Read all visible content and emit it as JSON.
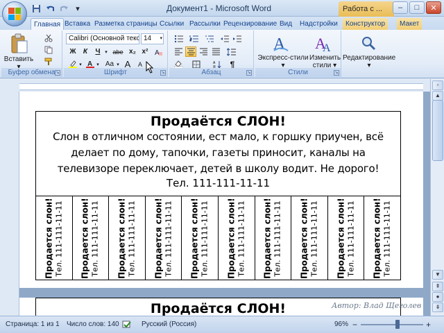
{
  "window": {
    "title": "Документ1 - Microsoft Word",
    "context_tab_title": "Работа с ...",
    "minimize": "–",
    "maximize": "□",
    "close": "✕"
  },
  "qat": {
    "save_icon": "save-icon",
    "undo_icon": "undo-icon",
    "redo_icon": "redo-icon",
    "customize_icon": "customize-qat-icon"
  },
  "tabs": [
    {
      "label": "Главная",
      "active": true
    },
    {
      "label": "Вставка"
    },
    {
      "label": "Разметка страницы"
    },
    {
      "label": "Ссылки"
    },
    {
      "label": "Рассылки"
    },
    {
      "label": "Рецензирование"
    },
    {
      "label": "Вид"
    },
    {
      "label": "Надстройки"
    },
    {
      "label": "Конструктор",
      "contextual": true
    },
    {
      "label": "Макет",
      "contextual": true
    }
  ],
  "ribbon": {
    "clipboard": {
      "label": "Буфер обмена",
      "paste_label": "Вставить"
    },
    "font": {
      "label": "Шрифт",
      "font_name": "Calibri (Основной текс",
      "font_size": "14",
      "bold": "Ж",
      "italic": "К",
      "underline": "Ч",
      "strike": "abe",
      "subscript": "x₂",
      "superscript": "x²",
      "change_case": "Aa",
      "grow": "A",
      "shrink": "A"
    },
    "paragraph": {
      "label": "Абзац"
    },
    "styles": {
      "label": "Стили",
      "express_label_1": "Экспресс-стили",
      "change_label_1": "Изменить",
      "change_label_2": "стили"
    },
    "editing": {
      "label": "Редактирование"
    }
  },
  "document": {
    "ad_title": "Продаётся СЛОН!",
    "ad_body": "Слон в отличном состоянии, ест мало, к горшку приучен, всё делает по дому, тапочки, газеты приносит, каналы на телевизоре переключает, детей в школу водит. Не дорого!",
    "ad_phone": "Тел. 111-111-11-11",
    "strip_title": "Продается слон!",
    "strip_phone": "Тел. 111-111-11-11",
    "strip_count": 10,
    "ad2_title": "Продаётся СЛОН!"
  },
  "watermark": "Автор: Влад Щеголев",
  "status": {
    "page": "Страница: 1 из 1",
    "words": "Число слов: 140",
    "language": "Русский (Россия)",
    "zoom": "96%"
  },
  "colors": {
    "accent": "#15428b",
    "ribbon_bg": "#e3ecf8",
    "highlight": "#f7c54e"
  }
}
